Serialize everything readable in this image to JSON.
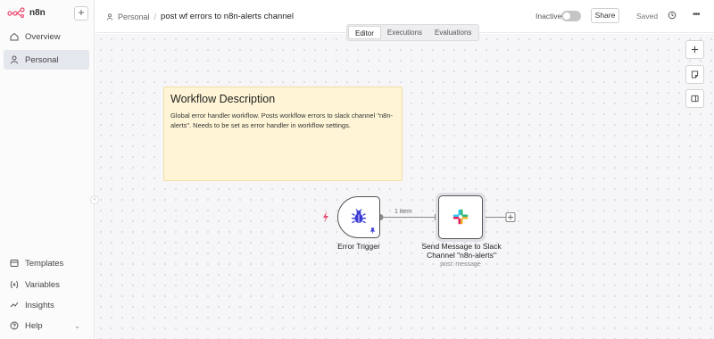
{
  "app": {
    "name": "n8n"
  },
  "sidebar": {
    "items": [
      {
        "label": "Overview",
        "icon": "home-icon"
      },
      {
        "label": "Personal",
        "icon": "user-icon"
      }
    ],
    "bottom_items": [
      {
        "label": "Templates",
        "icon": "templates-icon"
      },
      {
        "label": "Variables",
        "icon": "variables-icon"
      },
      {
        "label": "Insights",
        "icon": "insights-icon"
      },
      {
        "label": "Help",
        "icon": "help-icon"
      }
    ]
  },
  "header": {
    "breadcrumb_project": "Personal",
    "breadcrumb_sep": "/",
    "workflow_title": "post wf errors to n8n-alerts channel",
    "status_label": "Inactive",
    "share_label": "Share",
    "saved_label": "Saved"
  },
  "tabs": [
    "Editor",
    "Executions",
    "Evaluations"
  ],
  "sticky": {
    "title": "Workflow Description",
    "body": "Global error handler workflow. Posts workflow errors to slack channel \"n8n-alerts\". Needs to be set as error handler in workflow settings."
  },
  "nodes": {
    "trigger": {
      "label": "Error Trigger",
      "icon": "bug-icon"
    },
    "slack": {
      "label_line1": "Send Message to Slack",
      "label_line2": "Channel \"n8n-alerts\"",
      "subtitle": "post: message",
      "icon": "slack-icon"
    }
  },
  "connection": {
    "label": "1 item"
  },
  "colors": {
    "accent": "#ea4b71",
    "trigger_icon": "#3b3bd6",
    "sticky_bg": "#fff5d6"
  }
}
